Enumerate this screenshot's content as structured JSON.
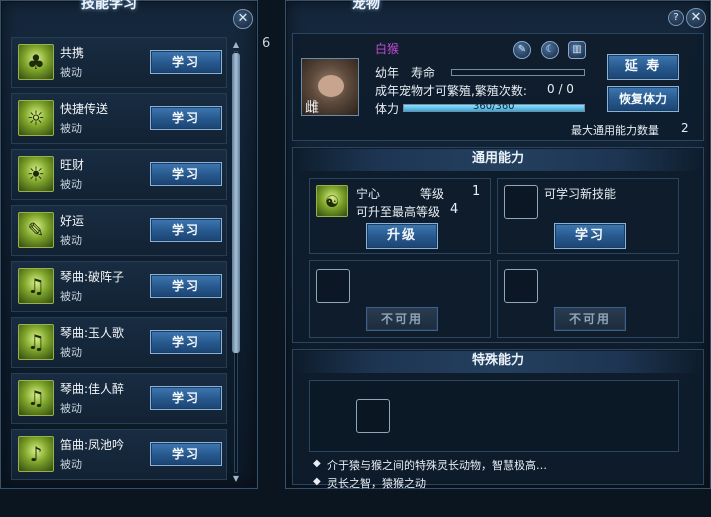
{
  "left_panel": {
    "title": "技能学习",
    "close": "✕",
    "skills": [
      {
        "name": "共携",
        "type": "被动",
        "button": "学习",
        "icon": "money-bag-icon",
        "glyph": "♣"
      },
      {
        "name": "快捷传送",
        "type": "被动",
        "button": "学习",
        "icon": "teleport-icon",
        "glyph": "☼"
      },
      {
        "name": "旺财",
        "type": "被动",
        "button": "学习",
        "icon": "sun-moon-icon",
        "glyph": "☀"
      },
      {
        "name": "好运",
        "type": "被动",
        "button": "学习",
        "icon": "luck-icon",
        "glyph": "✎"
      },
      {
        "name": "琴曲:破阵子",
        "type": "被动",
        "button": "学习",
        "icon": "zither-icon",
        "glyph": "♫"
      },
      {
        "name": "琴曲:玉人歌",
        "type": "被动",
        "button": "学习",
        "icon": "zither-icon",
        "glyph": "♫"
      },
      {
        "name": "琴曲:佳人醉",
        "type": "被动",
        "button": "学习",
        "icon": "zither-icon",
        "glyph": "♫"
      },
      {
        "name": "笛曲:凤池吟",
        "type": "被动",
        "button": "学习",
        "icon": "flute-icon",
        "glyph": "♪"
      }
    ]
  },
  "right_panel": {
    "title": "宠物",
    "help": "?",
    "close": "✕",
    "stray_digit": "6",
    "pet": {
      "name": "白猴",
      "gender": "雌",
      "stage_label": "幼年",
      "lifespan_label": "寿命",
      "lifespan_level": 0.0,
      "breed_info": "成年宠物才可繁殖,繁殖次数:",
      "breed_count": "0 / 0",
      "stamina_label": "体力",
      "stamina_value": "360/360",
      "stamina_level": 1.0
    },
    "buttons": {
      "extend_life": "延 寿",
      "restore_stamina": "恢复体力"
    },
    "max_ability_label": "最大通用能力数量",
    "max_ability_count": "2",
    "general": {
      "header": "通用能力",
      "skill": {
        "name": "宁心",
        "level_label": "等级",
        "level": "1",
        "max_label": "可升至最高等级",
        "max_level": "4",
        "button": "升级"
      },
      "learnable_label": "可学习新技能",
      "learn_button": "学习",
      "disabled_button": "不可用"
    },
    "special": {
      "header": "特殊能力",
      "desc1": "介于猿与猴之间的特殊灵长动物，智慧极高…",
      "desc2": "灵长之智，猿猴之动"
    }
  },
  "colors": {
    "pet_name": "#c24bd6",
    "button_blue": "#285a8f",
    "stamina_fill": "#3aa8d8"
  }
}
